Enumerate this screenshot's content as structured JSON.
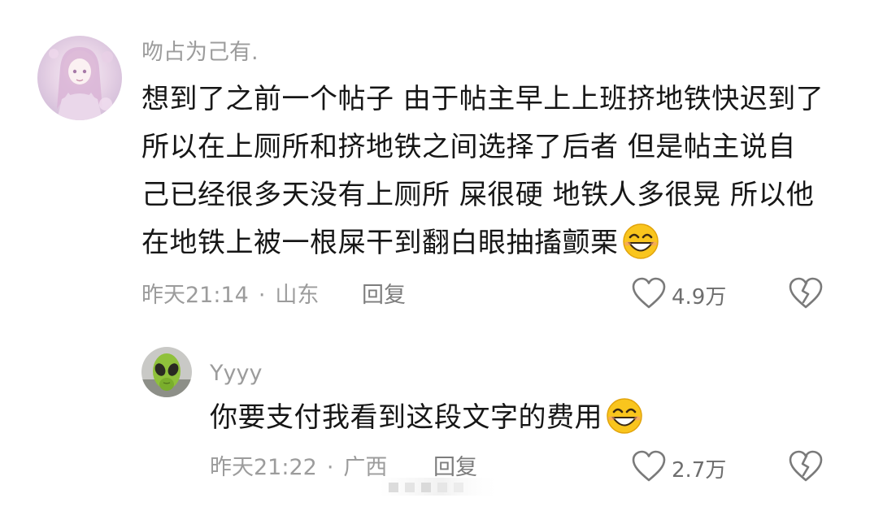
{
  "comments": [
    {
      "username": "吻占为己有.",
      "text_lines": [
        "想到了之前一个帖子 由于帖主早上上班挤地铁快迟到了",
        "所以在上厕所和挤地铁之间选择了后者 但是帖主说自",
        "己已经很多天没有上厕所 屎很硬 地铁人多很晃 所以他",
        "在地铁上被一根屎干到翻白眼抽搐颤栗"
      ],
      "emoji": "grinning-face-emoji",
      "time": "昨天21:14",
      "location": "山东",
      "reply_label": "回复",
      "likes": "4.9万"
    },
    {
      "username": "Yyyy",
      "text_lines": [
        "你要支付我看到这段文字的费用"
      ],
      "emoji": "grinning-face-emoji",
      "time": "昨天21:22",
      "location": "广西",
      "reply_label": "回复",
      "likes": "2.7万"
    }
  ],
  "separator": "·",
  "icons": {
    "like": "heart-outline-icon",
    "dislike": "broken-heart-icon"
  },
  "colors": {
    "meta_text": "#9c9c9c",
    "body_text": "#161616",
    "icon_stroke": "#7a7a7a"
  }
}
